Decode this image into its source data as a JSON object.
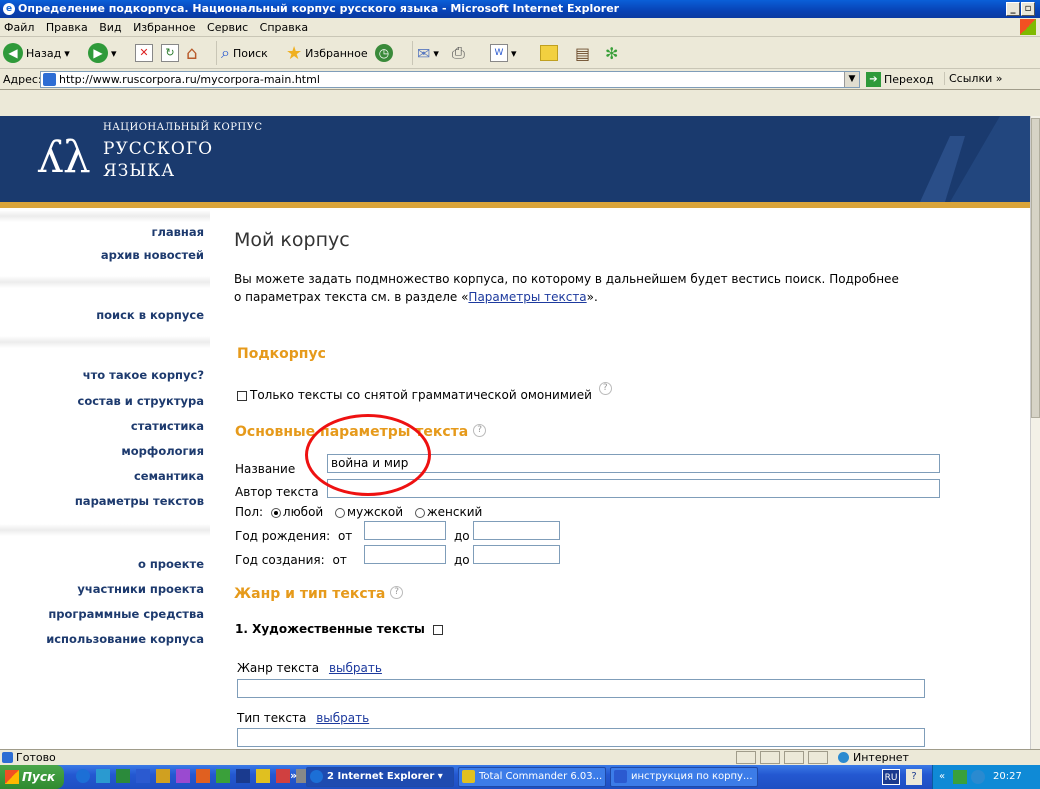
{
  "window": {
    "title": "Определение подкорпуса. Национальный корпус русского языка - Microsoft Internet Explorer"
  },
  "menu": [
    "Файл",
    "Правка",
    "Вид",
    "Избранное",
    "Сервис",
    "Справка"
  ],
  "toolbar": {
    "back": "Назад",
    "search": "Поиск",
    "favorites": "Избранное"
  },
  "address": {
    "label": "Адрес:",
    "url": "http://www.ruscorpora.ru/mycorpora-main.html",
    "go": "Переход",
    "links": "Ссылки"
  },
  "banner": {
    "line1": "НАЦИОНАЛЬНЫЙ КОРПУС",
    "line2": "РУССКОГО",
    "line3": "ЯЗЫКА"
  },
  "nav": {
    "group1": [
      "главная",
      "архив новостей"
    ],
    "group2": [
      "поиск в корпусе"
    ],
    "group3": [
      "что такое корпус?",
      "состав и структура",
      "статистика",
      "морфология",
      "семантика",
      "параметры текстов"
    ],
    "group4": [
      "о проекте",
      "участники проекта",
      "программные средства",
      "использование корпуса"
    ]
  },
  "content": {
    "title": "Мой корпус",
    "intro_line1": "Вы можете задать подмножество корпуса, по которому в дальнейшем будет вестись поиск. Подробнее",
    "intro_line2_pre": "о параметрах текста см. в разделе «",
    "intro_link": "Параметры текста",
    "intro_line2_post": "».",
    "subcorpus_heading": "Подкорпус",
    "only_disambiguated": "Только тексты со снятой грамматической омонимией",
    "help_mark": "?",
    "main_params_heading": "Основные параметры текста",
    "name_label": "Название",
    "name_value": "война и мир",
    "author_label": "Автор текста",
    "author_value": "",
    "gender_label": "Пол:",
    "gender_options": [
      "любой",
      "мужской",
      "женский"
    ],
    "birth_label": "Год рождения:",
    "creation_label": "Год создания:",
    "from": "от",
    "to": "до",
    "genre_heading": "Жанр и тип текста",
    "fiction_label": "1. Художественные тексты",
    "genre_label": "Жанр текста",
    "type_label": "Тип текста",
    "choose": "выбрать"
  },
  "status": {
    "text": "Готово",
    "zone": "Интернет"
  },
  "taskbar": {
    "start": "Пуск",
    "tasks": [
      "2 Internet Explorer",
      "Total Commander 6.03...",
      "инструкция по корпу..."
    ],
    "lang": "RU",
    "time": "20:27"
  }
}
